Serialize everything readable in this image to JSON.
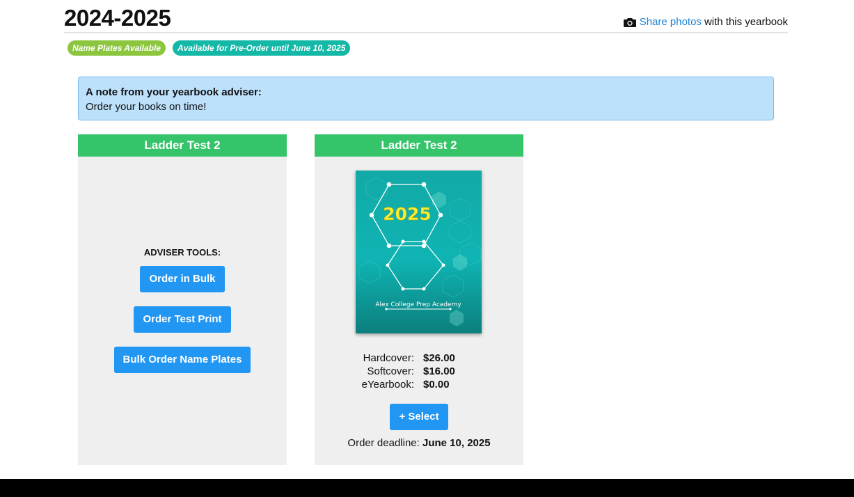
{
  "header": {
    "title": "2024-2025",
    "share_link": "Share photos",
    "share_suffix": "with this yearbook"
  },
  "badges": {
    "name_plates": "Name Plates Available",
    "preorder": "Available for Pre-Order until June 10, 2025"
  },
  "note": {
    "title": "A note from your yearbook adviser:",
    "body": "Order your books on time!"
  },
  "adviser_card": {
    "title": "Ladder Test 2",
    "tools_label": "ADVISER TOOLS:",
    "buttons": [
      "Order in Bulk",
      "Order Test Print",
      "Bulk Order Name Plates"
    ]
  },
  "book_card": {
    "title": "Ladder Test 2",
    "cover": {
      "year": "2025",
      "school": "Alex College Prep Academy"
    },
    "prices": [
      {
        "label": "Hardcover:",
        "value": "$26.00"
      },
      {
        "label": "Softcover:",
        "value": "$16.00"
      },
      {
        "label": "eYearbook:",
        "value": "$0.00"
      }
    ],
    "select_label": "+ Select",
    "deadline_label": "Order deadline:",
    "deadline_date": "June 10, 2025"
  },
  "icons": {
    "share": "camera-icon"
  },
  "colors": {
    "card_header": "#36c46a",
    "button": "#2196f3",
    "link": "#1a82d6",
    "badge_green": "#8cc63f",
    "badge_teal": "#14b8a6",
    "note_bg": "#bde0fb"
  }
}
